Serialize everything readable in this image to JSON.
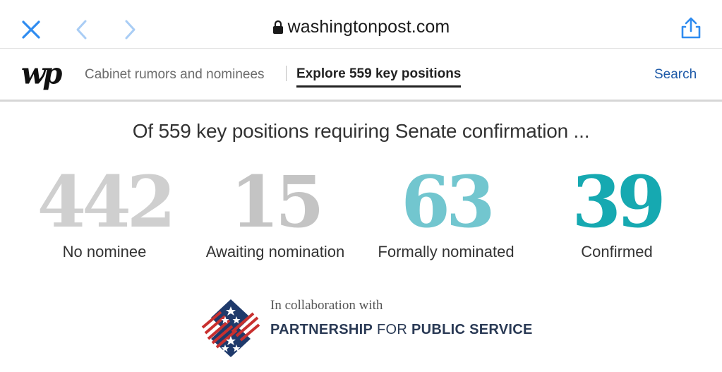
{
  "browser": {
    "url": "washingtonpost.com"
  },
  "header": {
    "logo_text": "wp",
    "tabs": [
      {
        "label": "Cabinet rumors and nominees"
      },
      {
        "label": "Explore 559 key positions"
      }
    ],
    "search_label": "Search"
  },
  "main": {
    "headline": "Of 559 key positions requiring Senate confirmation ...",
    "stats": [
      {
        "value": "442",
        "label": "No nominee",
        "color": "#cfcfcf"
      },
      {
        "value": "15",
        "label": "Awaiting nomination",
        "color": "#c4c4c4"
      },
      {
        "value": "63",
        "label": "Formally nominated",
        "color": "#72c6cf"
      },
      {
        "value": "39",
        "label": "Confirmed",
        "color": "#16a9b1"
      }
    ]
  },
  "footer": {
    "collab_text": "In collaboration with",
    "org_part1": "PARTNERSHIP",
    "org_part2": " FOR ",
    "org_part3": "PUBLIC SERVICE"
  }
}
